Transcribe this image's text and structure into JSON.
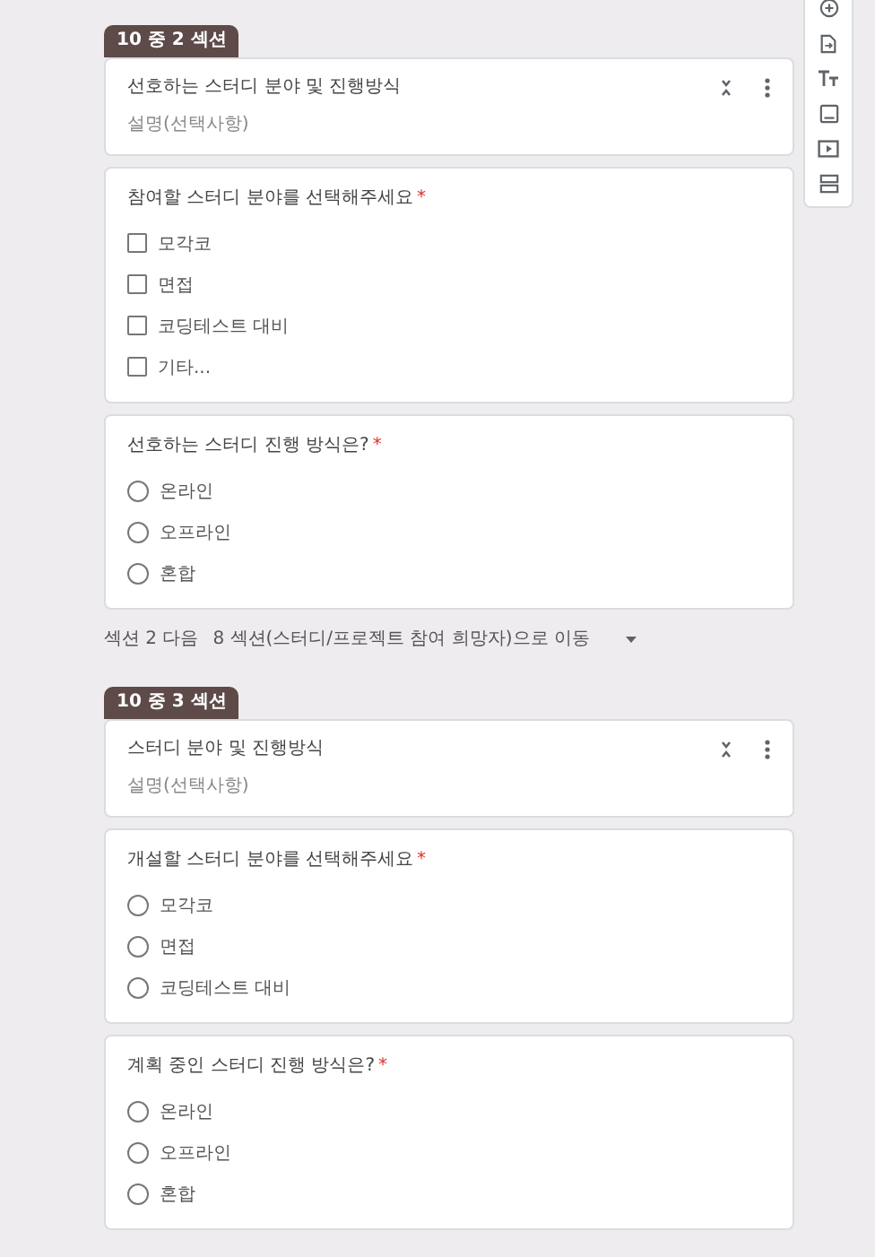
{
  "required_mark": "*",
  "sections": [
    {
      "badge": "10 중 2 섹션",
      "title": "선호하는 스터디 분야 및 진행방식",
      "description": "설명(선택사항)",
      "questions": [
        {
          "kind": "checkbox",
          "title": "참여할 스터디 분야를 선택해주세요",
          "required": true,
          "options": [
            {
              "label": "모각코",
              "checked": false
            },
            {
              "label": "면접",
              "checked": false
            },
            {
              "label": "코딩테스트 대비",
              "checked": false
            },
            {
              "label": "기타...",
              "checked": false
            }
          ]
        },
        {
          "kind": "radio",
          "title": "선호하는 스터디 진행 방식은?",
          "required": true,
          "options": [
            {
              "label": "온라인",
              "selected": false
            },
            {
              "label": "오프라인",
              "selected": false
            },
            {
              "label": "혼합",
              "selected": false
            }
          ]
        }
      ],
      "after": {
        "label": "섹션 2 다음",
        "target": "8 섹션(스터디/프로젝트 참여 희망자)으로 이동"
      }
    },
    {
      "badge": "10 중 3 섹션",
      "title": "스터디 분야 및 진행방식",
      "description": "설명(선택사항)",
      "questions": [
        {
          "kind": "radio",
          "title": "개설할 스터디 분야를 선택해주세요",
          "required": true,
          "options": [
            {
              "label": "모각코",
              "selected": false
            },
            {
              "label": "면접",
              "selected": false
            },
            {
              "label": "코딩테스트 대비",
              "selected": false
            }
          ]
        },
        {
          "kind": "radio",
          "title": "계획 중인 스터디 진행 방식은?",
          "required": true,
          "options": [
            {
              "label": "온라인",
              "selected": false
            },
            {
              "label": "오프라인",
              "selected": false
            },
            {
              "label": "혼합",
              "selected": false
            }
          ]
        }
      ]
    }
  ]
}
